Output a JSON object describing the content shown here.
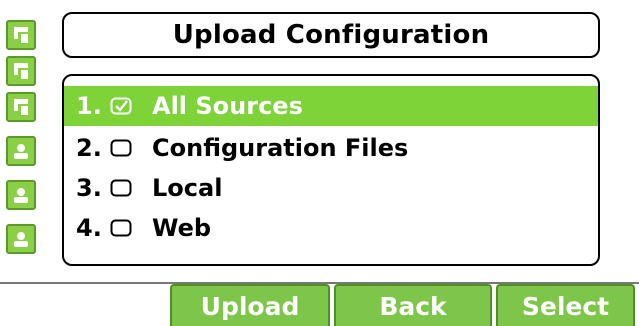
{
  "title": "Upload Configuration",
  "line_keys": [
    {
      "icon": "phone-line-icon"
    },
    {
      "icon": "phone-line-icon"
    },
    {
      "icon": "phone-line-icon"
    },
    {
      "icon": "contact-icon"
    },
    {
      "icon": "contact-icon"
    },
    {
      "icon": "contact-icon"
    }
  ],
  "options": [
    {
      "index": "1.",
      "label": "All Sources",
      "checked": true,
      "selected": true
    },
    {
      "index": "2.",
      "label": "Configuration Files",
      "checked": false,
      "selected": false
    },
    {
      "index": "3.",
      "label": "Local",
      "checked": false,
      "selected": false
    },
    {
      "index": "4.",
      "label": "Web",
      "checked": false,
      "selected": false
    }
  ],
  "softkeys": {
    "upload": "Upload",
    "back": "Back",
    "select": "Select"
  },
  "colors": {
    "accent_green": "#7ed338",
    "softkey_green": "#7ec64a",
    "linekey_green": "#8bcf47"
  }
}
